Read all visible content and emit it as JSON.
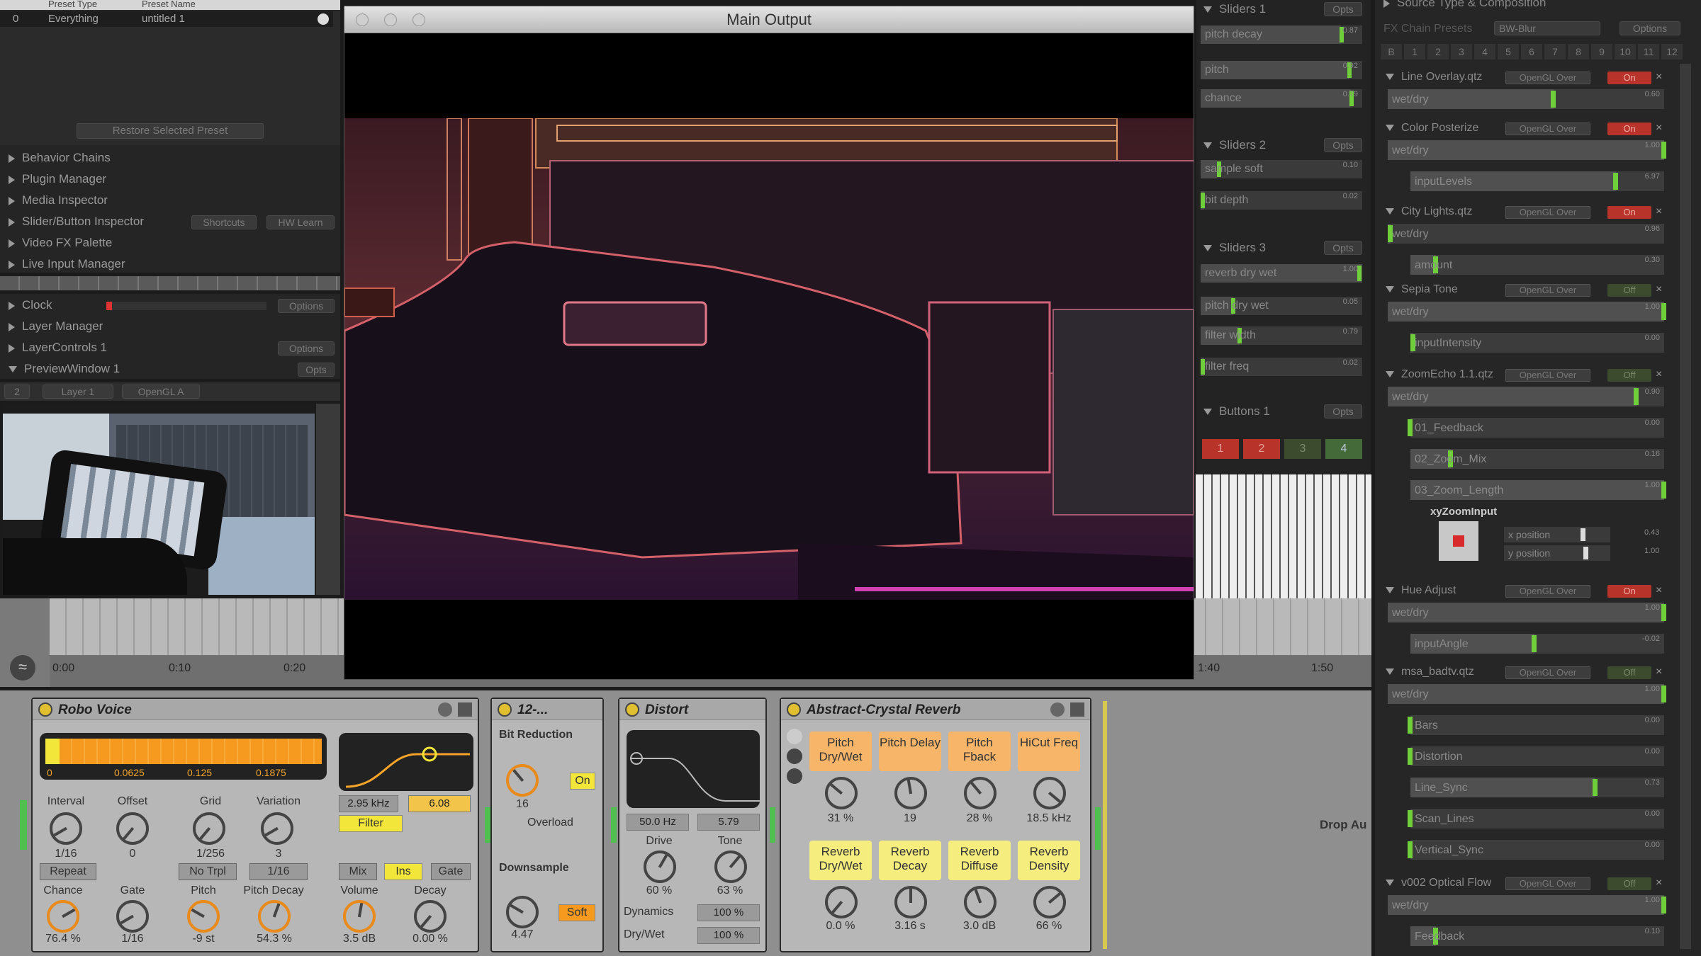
{
  "preset_browser": {
    "col_type": "Preset Type",
    "col_name": "Preset Name",
    "row_index": "0",
    "row_type": "Everything",
    "row_name": "untitled 1",
    "restore_button": "Restore Selected Preset"
  },
  "left_menu": [
    {
      "label": "Behavior Chains"
    },
    {
      "label": "Plugin Manager"
    },
    {
      "label": "Media Inspector"
    },
    {
      "label": "Slider/Button Inspector",
      "btn1": "Shortcuts",
      "btn2": "HW Learn"
    },
    {
      "label": "Video FX Palette"
    },
    {
      "label": "Live Input Manager"
    }
  ],
  "left_menu2": [
    {
      "label": "Clock",
      "btn": "Options"
    },
    {
      "label": "Layer Manager"
    },
    {
      "label": "LayerControls 1",
      "btn": "Options"
    },
    {
      "label": "PreviewWindow 1",
      "btn": "Opts"
    }
  ],
  "preview_tabs": {
    "num": "2",
    "layer": "Layer 1",
    "gl": "OpenGL A"
  },
  "main_output": {
    "title": "Main Output"
  },
  "timeline": {
    "ticks": [
      "0:00",
      "0:10",
      "0:20",
      "1:40",
      "1:50"
    ]
  },
  "sliders_panels": [
    {
      "title": "Sliders 1",
      "opts": "Opts",
      "items": [
        {
          "name": "pitch decay",
          "value": "0.87",
          "level": 0.87
        },
        {
          "name": "pitch",
          "value": "0.92",
          "level": 0.92
        },
        {
          "name": "chance",
          "value": "0.79",
          "level": 0.79
        }
      ]
    },
    {
      "title": "Sliders 2",
      "opts": "Opts",
      "items": [
        {
          "name": "sample soft",
          "value": "0.10",
          "level": 0.1
        },
        {
          "name": "bit depth",
          "value": "0.02",
          "level": 0.02
        }
      ]
    },
    {
      "title": "Sliders 3",
      "opts": "Opts",
      "items": [
        {
          "name": "reverb dry wet",
          "value": "1.00",
          "level": 1.0
        },
        {
          "name": "pitch dry wet",
          "value": "0.05",
          "level": 0.05
        },
        {
          "name": "filter width",
          "value": "0.79",
          "level": 0.79
        },
        {
          "name": "filter freq",
          "value": "0.02",
          "level": 0.02
        }
      ]
    }
  ],
  "buttons_panel": {
    "title": "Buttons 1",
    "opts": "Opts",
    "buttons": [
      "1",
      "2",
      "3",
      "4"
    ]
  },
  "fx_panel": {
    "title": "Source Type & Composition",
    "presets_label": "FX Chain Presets",
    "preset_value": "BW-Blur",
    "options": "Options",
    "tabs": [
      "B",
      "1",
      "2",
      "3",
      "4",
      "5",
      "6",
      "7",
      "8",
      "9",
      "10",
      "11",
      "12"
    ],
    "opengl_label": "OpenGL Over",
    "chains": [
      {
        "name": "Line Overlay.qtz",
        "state": "On",
        "sliders": [
          {
            "name": "wet/dry",
            "value": "0.60",
            "level": 0.6
          }
        ]
      },
      {
        "name": "Color Posterize",
        "state": "On",
        "sliders": [
          {
            "name": "wet/dry",
            "value": "1.00",
            "level": 1.0
          },
          {
            "name": "inputLevels",
            "value": "6.97",
            "level": 0.81
          }
        ]
      },
      {
        "name": "City Lights.qtz",
        "state": "On",
        "sliders": [
          {
            "name": "wet/dry",
            "value": "0.96",
            "level": 0.01
          },
          {
            "name": "amount",
            "value": "0.30",
            "level": 0.1
          }
        ]
      },
      {
        "name": "Sepia Tone",
        "state": "Off",
        "sliders": [
          {
            "name": "wet/dry",
            "value": "1.00",
            "level": 1.0
          },
          {
            "name": "inputIntensity",
            "value": "0.00",
            "level": 0.01
          }
        ]
      },
      {
        "name": "ZoomEcho 1.1.qtz",
        "state": "Off",
        "sliders": [
          {
            "name": "wet/dry",
            "value": "0.90",
            "level": 0.9
          },
          {
            "name": "01_Feedback",
            "value": "0.00",
            "level": 0.0
          },
          {
            "name": "02_Zoom_Mix",
            "value": "0.16",
            "level": 0.16
          },
          {
            "name": "03_Zoom_Length",
            "value": "1.00",
            "level": 1.0
          }
        ]
      },
      {
        "name": "Hue Adjust",
        "state": "On",
        "sliders": [
          {
            "name": "wet/dry",
            "value": "1.00",
            "level": 1.0
          },
          {
            "name": "inputAngle",
            "value": "-0.02",
            "level": 0.49
          }
        ]
      },
      {
        "name": "msa_badtv.qtz",
        "state": "Off",
        "sliders": [
          {
            "name": "wet/dry",
            "value": "1.00",
            "level": 1.0
          },
          {
            "name": "Bars",
            "value": "0.00",
            "level": 0.0
          },
          {
            "name": "Distortion",
            "value": "0.00",
            "level": 0.0
          },
          {
            "name": "Line_Sync",
            "value": "0.73",
            "level": 0.73
          },
          {
            "name": "Scan_Lines",
            "value": "0.00",
            "level": 0.0
          },
          {
            "name": "Vertical_Sync",
            "value": "0.00",
            "level": 0.0
          }
        ]
      },
      {
        "name": "v002 Optical Flow",
        "state": "Off",
        "sliders": [
          {
            "name": "wet/dry",
            "value": "1.00",
            "level": 1.0
          },
          {
            "name": "Feedback",
            "value": "0.10",
            "level": 0.1
          }
        ]
      }
    ],
    "xy": {
      "label": "xyZoomInput",
      "x_label": "x position",
      "x_value": "0.43",
      "y_label": "y position",
      "y_value": "1.00"
    }
  },
  "robo_voice": {
    "title": "Robo Voice",
    "ticks": [
      "0",
      "0.0625",
      "0.125",
      "0.1875"
    ],
    "freq": "2.95 kHz",
    "q": "6.08",
    "filter": "Filter",
    "knobs1": [
      {
        "label": "Interval",
        "value": "1/16"
      },
      {
        "label": "Offset",
        "value": "0"
      },
      {
        "label": "Grid",
        "value": "1/256"
      },
      {
        "label": "Variation",
        "value": "3"
      }
    ],
    "repeat": "Repeat",
    "no_trpl": "No Trpl",
    "grid_sel": "1/16",
    "mix": "Mix",
    "ins": "Ins",
    "gate_btn": "Gate",
    "knobs2": [
      {
        "label": "Chance",
        "value": "76.4 %"
      },
      {
        "label": "Gate",
        "value": "1/16"
      },
      {
        "label": "Pitch",
        "value": "-9 st"
      },
      {
        "label": "Pitch Decay",
        "value": "54.3 %"
      },
      {
        "label": "Volume",
        "value": "3.5 dB"
      },
      {
        "label": "Decay",
        "value": "0.00 %"
      }
    ]
  },
  "bit_device": {
    "title": "12-...",
    "bit_reduction": "Bit Reduction",
    "on": "On",
    "bits": "16",
    "overload": "Overload",
    "downsample": "Downsample",
    "soft": "Soft",
    "ds_value": "4.47"
  },
  "distort": {
    "title": "Distort",
    "freq": "50.0 Hz",
    "q": "5.79",
    "drive_label": "Drive",
    "drive_value": "60 %",
    "tone_label": "Tone",
    "tone_value": "63 %",
    "dynamics_label": "Dynamics",
    "dynamics_value": "100 %",
    "drywet_label": "Dry/Wet",
    "drywet_value": "100 %"
  },
  "reverb": {
    "title": "Abstract-Crystal Reverb",
    "pads_top": [
      {
        "label": "Pitch Dry/Wet",
        "value": "31 %"
      },
      {
        "label": "Pitch Delay",
        "value": "19"
      },
      {
        "label": "Pitch Fback",
        "value": "28 %"
      },
      {
        "label": "HiCut Freq",
        "value": "18.5 kHz"
      }
    ],
    "pads_bottom": [
      {
        "label": "Reverb Dry/Wet",
        "value": "0.0 %"
      },
      {
        "label": "Reverb Decay",
        "value": "3.16 s"
      },
      {
        "label": "Reverb Diffuse",
        "value": "3.0 dB"
      },
      {
        "label": "Reverb Density",
        "value": "66 %"
      }
    ]
  },
  "drop_area": {
    "text": "Drop Au"
  }
}
